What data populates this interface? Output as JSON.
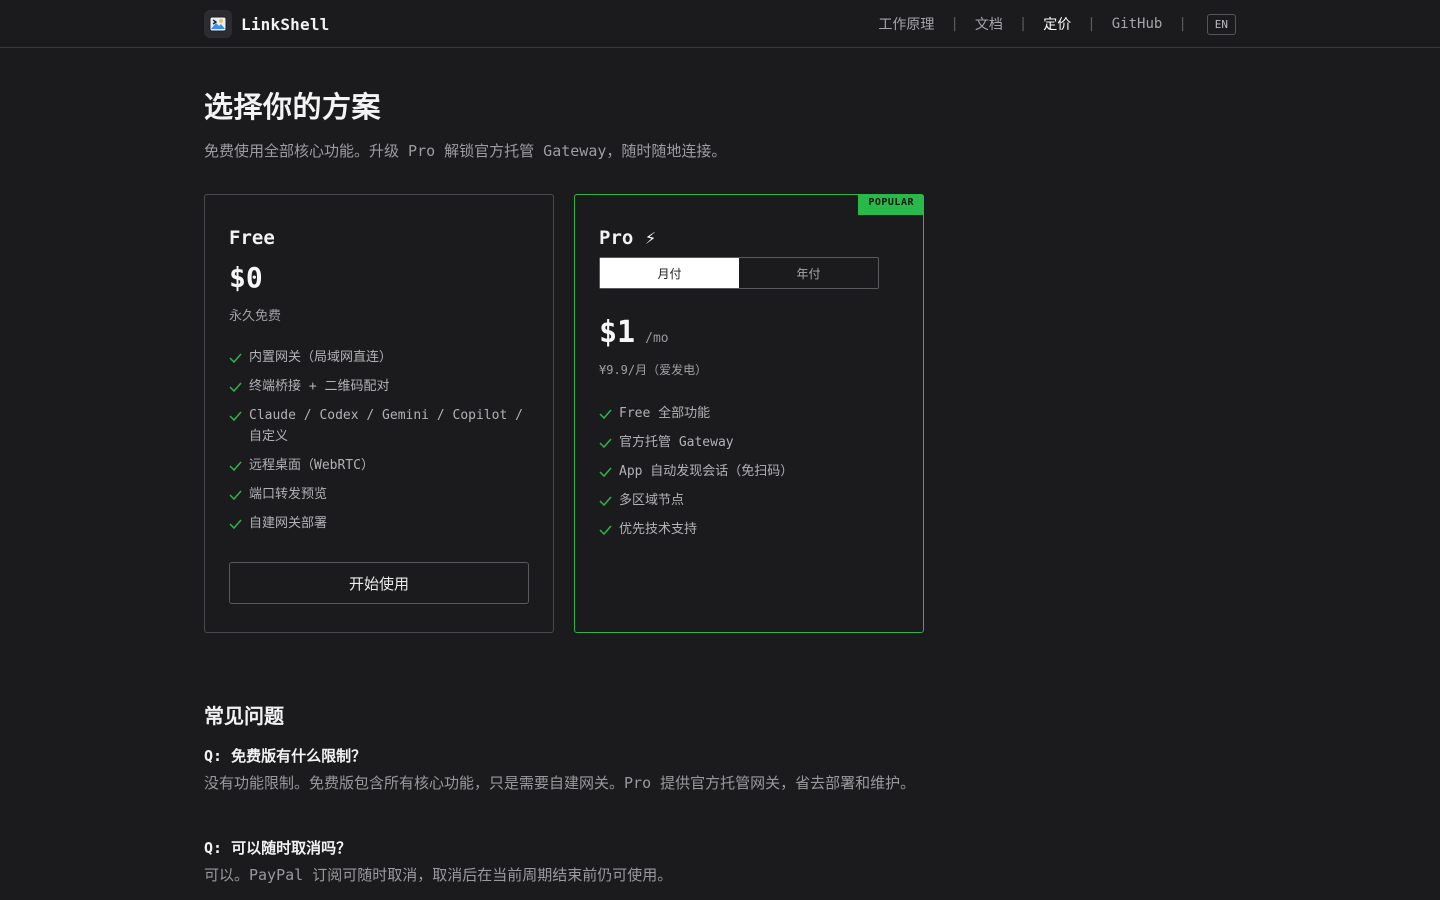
{
  "brand": {
    "name": "LinkShell"
  },
  "nav": {
    "items": [
      {
        "label": "工作原理"
      },
      {
        "label": "文档"
      },
      {
        "label": "定价"
      },
      {
        "label": "GitHub"
      }
    ],
    "active": "定价",
    "lang": "EN"
  },
  "hero": {
    "title": "选择你的方案",
    "subtitle": "免费使用全部核心功能。升级 Pro 解锁官方托管 Gateway，随时随地连接。"
  },
  "free_plan": {
    "name": "Free",
    "price": "$0",
    "note": "永久免费",
    "features": [
      "内置网关（局域网直连）",
      "终端桥接 + 二维码配对",
      "Claude / Codex / Gemini / Copilot / 自定义",
      "远程桌面（WebRTC）",
      "端口转发预览",
      "自建网关部署"
    ],
    "cta": "开始使用"
  },
  "pro_plan": {
    "badge": "POPULAR",
    "name": "Pro ⚡",
    "billing": {
      "monthly": "月付",
      "yearly": "年付",
      "selected": "月付"
    },
    "price": "$1",
    "period": "/mo",
    "note": "¥9.9/月（爱发电）",
    "features": [
      "Free 全部功能",
      "官方托管 Gateway",
      "App 自动发现会话（免扫码）",
      "多区域节点",
      "优先技术支持"
    ]
  },
  "faq": {
    "title": "常见问题",
    "items": [
      {
        "q": "Q: 免费版有什么限制？",
        "a": "没有功能限制。免费版包含所有核心功能，只是需要自建网关。Pro 提供官方托管网关，省去部署和维护。"
      },
      {
        "q": "Q: 可以随时取消吗？",
        "a": "可以。PayPal 订阅可随时取消，取消后在当前周期结束前仍可使用。"
      }
    ]
  },
  "colors": {
    "background": "#1b1b1e",
    "accent": "#29b84a",
    "border": "#4a4a4e"
  }
}
